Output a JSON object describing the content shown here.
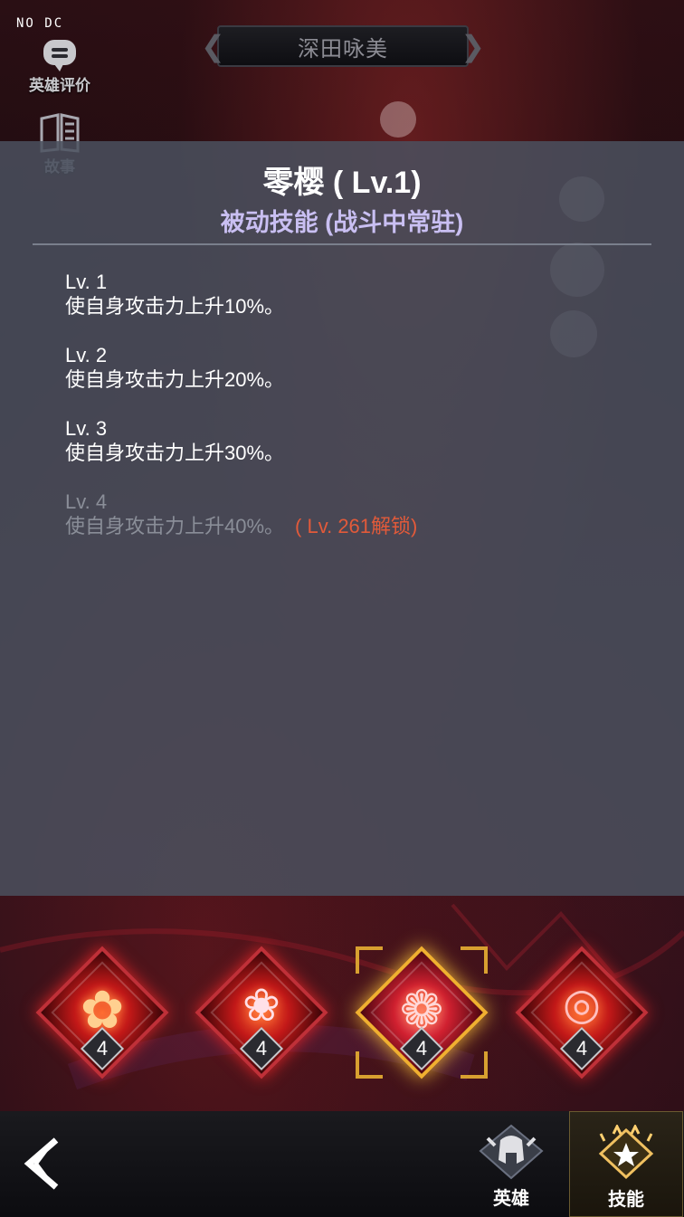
{
  "overlay_text": "NO DC",
  "side_buttons": {
    "review": {
      "label": "英雄评价",
      "icon": "speech-bubble-icon"
    },
    "story": {
      "label": "故事",
      "icon": "book-icon"
    }
  },
  "hero_name": "深田咏美",
  "skill_panel": {
    "title": "零樱 ( Lv.1)",
    "subtitle": "被动技能 (战斗中常驻)",
    "levels": [
      {
        "level": "Lv. 1",
        "desc": "使自身攻击力上升10%。",
        "locked": false
      },
      {
        "level": "Lv. 2",
        "desc": "使自身攻击力上升20%。",
        "locked": false
      },
      {
        "level": "Lv. 3",
        "desc": "使自身攻击力上升30%。",
        "locked": false
      },
      {
        "level": "Lv. 4",
        "desc": "使自身攻击力上升40%。",
        "locked": true,
        "unlock_note": "( Lv. 261解锁)"
      }
    ]
  },
  "skills": [
    {
      "icon": "sakura-flower-icon",
      "level_badge": "4",
      "selected": false
    },
    {
      "icon": "petal-swirl-icon",
      "level_badge": "4",
      "selected": false
    },
    {
      "icon": "sakura-dancer-icon",
      "level_badge": "4",
      "selected": true
    },
    {
      "icon": "sakura-eye-icon",
      "level_badge": "4",
      "selected": false
    }
  ],
  "bottom_nav": {
    "back_icon": "back-arrow-icon",
    "tabs": [
      {
        "label": "英雄",
        "icon": "helmet-icon",
        "selected": false
      },
      {
        "label": "技能",
        "icon": "skill-emblem-icon",
        "selected": true
      }
    ]
  },
  "colors": {
    "panel_bg": "#4a505e",
    "subtitle": "#c9bff2",
    "unlock_note": "#e25a3a",
    "locked_text": "#8a8e98",
    "selected_border": "#f0b030",
    "skill_border": "#c03038"
  }
}
